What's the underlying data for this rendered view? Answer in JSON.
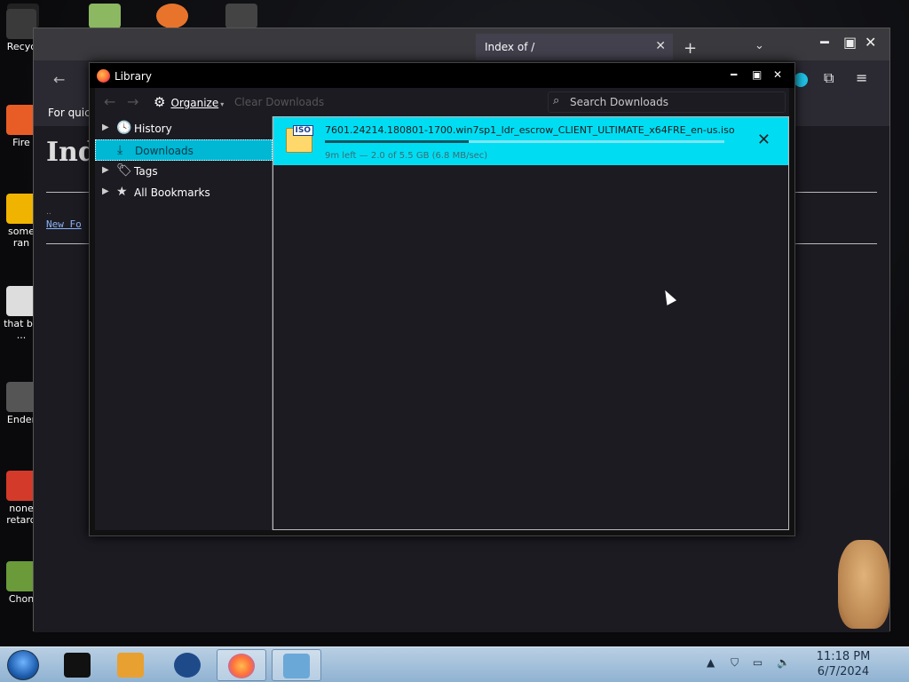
{
  "desktop": {
    "icons": [
      {
        "label": "Recyc",
        "color": "#3a3a3a"
      },
      {
        "label": "Fire",
        "color": "#e85d26"
      },
      {
        "label": "some\nran",
        "color": "#f0b400"
      },
      {
        "label": "that bu\n...",
        "color": "#dddddd"
      },
      {
        "label": "Ender",
        "color": "#555555"
      },
      {
        "label": "none\nretard",
        "color": "#d43a2a"
      },
      {
        "label": "Chon",
        "color": "#6a9a3a"
      }
    ]
  },
  "browser": {
    "active_tab": "Index of /",
    "bookmarks_bar_text": "For quic",
    "page": {
      "heading": "Ind",
      "link_prefix": "..",
      "link_text": "New Fo"
    }
  },
  "library": {
    "title": "Library",
    "toolbar": {
      "organize": "Organize",
      "clear_downloads": "Clear Downloads",
      "search_placeholder": "Search Downloads"
    },
    "sidebar": [
      {
        "label": "History",
        "icon": "clock-icon",
        "glyph": "🕓"
      },
      {
        "label": "Downloads",
        "icon": "download-icon",
        "glyph": "⤓"
      },
      {
        "label": "Tags",
        "icon": "tag-icon",
        "glyph": "🏷"
      },
      {
        "label": "All Bookmarks",
        "icon": "star-icon",
        "glyph": "★"
      }
    ],
    "download": {
      "filename": "7601.24214.180801-1700.win7sp1_ldr_escrow_CLIENT_ULTIMATE_x64FRE_en-us.iso",
      "file_tag": "ISO",
      "status": "9m left — 2.0 of 5.5 GB (6.8 MB/sec)",
      "progress_fraction": 0.36
    }
  },
  "taskbar": {
    "clock_time": "11:18 PM",
    "clock_date": "6/7/2024"
  },
  "colors": {
    "selection": "#00b7d4",
    "download_highlight": "#00ddf3"
  }
}
